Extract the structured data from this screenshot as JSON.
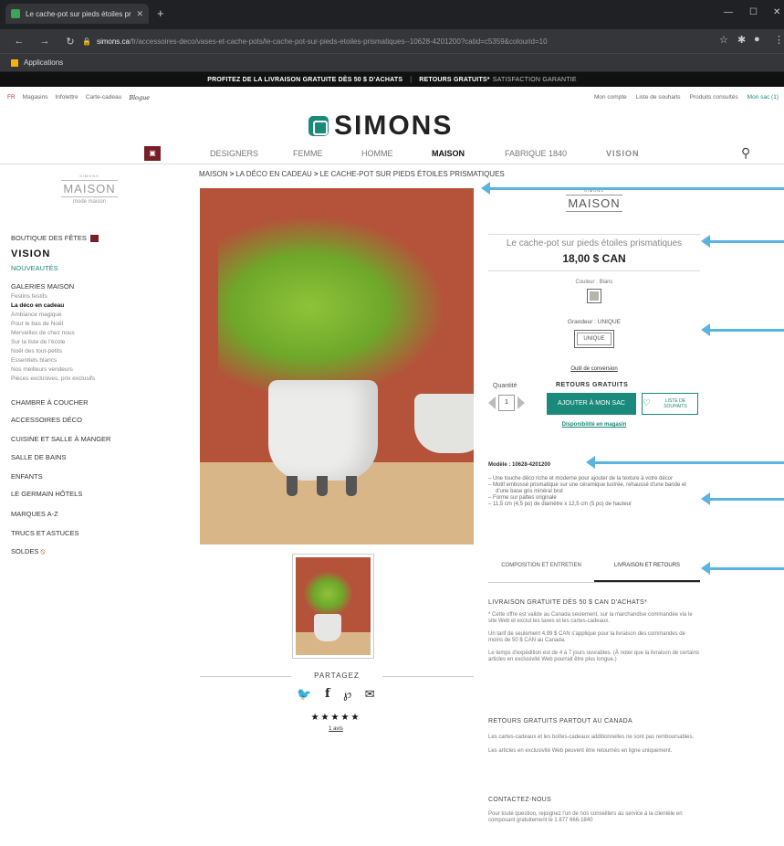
{
  "browser": {
    "tab_title": "Le cache-pot sur pieds étoiles pr",
    "url_domain": "simons.ca",
    "url_path": "/fr/accessoires-deco/vases-et-cache-pots/le-cache-pot-sur-pieds-etoiles-prismatiques--10628-4201200?catid=c5359&colourid=10",
    "bookmark": "Applications"
  },
  "promo": {
    "left": "PROFITEZ DE LA LIVRAISON GRATUITE DÈS 50 $ D'ACHATS",
    "sep": "|",
    "right_bold": "RETOURS GRATUITS*",
    "right": "SATISFACTION GARANTIE"
  },
  "util": {
    "lang": "FR",
    "links": [
      "Magasins",
      "Infolettre",
      "Carte-cadeau"
    ],
    "blog": "Blogue",
    "account": "Mon compte",
    "wishlist": "Liste de souhaits",
    "viewed": "Produits consultés",
    "bag": "Mon sac (1)"
  },
  "brand": "SIMONS",
  "nav": {
    "items": [
      "DESIGNERS",
      "FEMME",
      "HOMME",
      "MAISON",
      "FABRIQUE 1840",
      "VISION"
    ]
  },
  "breadcrumb": {
    "a": "MAISON",
    "b": "LA DÉCO EN CADEAU",
    "c": "LE CACHE-POT SUR PIEDS ÉTOILES PRISMATIQUES",
    "sep": ">"
  },
  "mmaison": {
    "small": "SIMONS",
    "name": "MAISON",
    "sub": "mode maison"
  },
  "side": {
    "fetes": "BOUTIQUE DES FÊTES",
    "vision": "VISION",
    "nouveautes": "NOUVEAUTÉS",
    "galeries": "GALERIES MAISON",
    "sub": [
      "Festins festifs",
      "La déco en cadeau",
      "Ambiance magique",
      "Pour le bas de Noël",
      "Merveilles de chez nous",
      "Sur la liste de l'école",
      "Noël des tout-petits",
      "Essentiels blancs",
      "Nos meilleurs vendeurs",
      "Pièces exclusives, prix exclusifs"
    ],
    "cats": [
      "CHAMBRE À COUCHER",
      "ACCESSOIRES DÉCO",
      "CUISINE ET SALLE À MANGER",
      "SALLE DE BAINS",
      "ENFANTS",
      "LE GERMAIN HÔTELS",
      "MARQUES A-Z",
      "TRUCS ET ASTUCES",
      "SOLDES"
    ]
  },
  "share": {
    "label": "PARTAGEZ",
    "stars": "★★★★★",
    "reviews": "1 avis"
  },
  "product": {
    "brand_small": "SIMONS",
    "brand": "MAISON",
    "name": "Le cache-pot sur pieds étoiles prismatiques",
    "price": "18,00 $ CAN",
    "color_label": "Couleur : Blanc",
    "size_label": "Grandeur : UNIQUE",
    "size": "UNIQUE",
    "conversion": "Outil de conversion",
    "qty_label": "Quantité",
    "qty": "1",
    "free_returns": "RETOURS GRATUITS",
    "add": "AJOUTER À MON SAC",
    "wish": "LISTE DE SOUHAITS",
    "store": "Disponibilité en magasin",
    "model": "Modèle : 10628-4201200",
    "features": [
      "Une touche déco riche et moderne pour ajouter de la texture à votre décor",
      "Motif embossé prismatique sur une céramique lustrée, rehaussé d'une bande et d'une base gris minéral brut",
      "Forme sur pattes originale",
      "11,5 cm (4,5 po) de diamètre x 12,5 cm (5 po) de hauteur"
    ],
    "tab1": "COMPOSITION ET ENTRETIEN",
    "tab2": "LIVRAISON ET RETOURS",
    "ship_h": "LIVRAISON GRATUITE DÈS 50 $ CAN D'ACHATS*",
    "ship_p1": "* Cette offre est valide au Canada seulement, sur la marchandise commandée via le site Web et exclut les taxes et les cartes-cadeaux.",
    "ship_p2": "Un tarif de seulement 4,99 $ CAN s'applique pour la livraison des commandes de moins de 50 $ CAN au Canada.",
    "ship_p3": "Le temps d'expédition est de 4 à 7 jours ouvrables. (À noter que la livraison de certains articles en exclusivité Web pourrait être plus longue.)",
    "ret_h": "RETOURS GRATUITS PARTOUT AU CANADA",
    "ret_p1": "Les cartes-cadeaux et les boîtes-cadeaux additionnelles ne sont pas remboursables.",
    "ret_p2": "Les articles en exclusivité Web peuvent être retournés en ligne uniquement.",
    "contact_h": "CONTACTEZ-NOUS",
    "contact_p": "Pour toute question, rejoignez l'un de nos conseillers au service à la clientèle en composant gratuitement le 1 877 666-1840"
  }
}
